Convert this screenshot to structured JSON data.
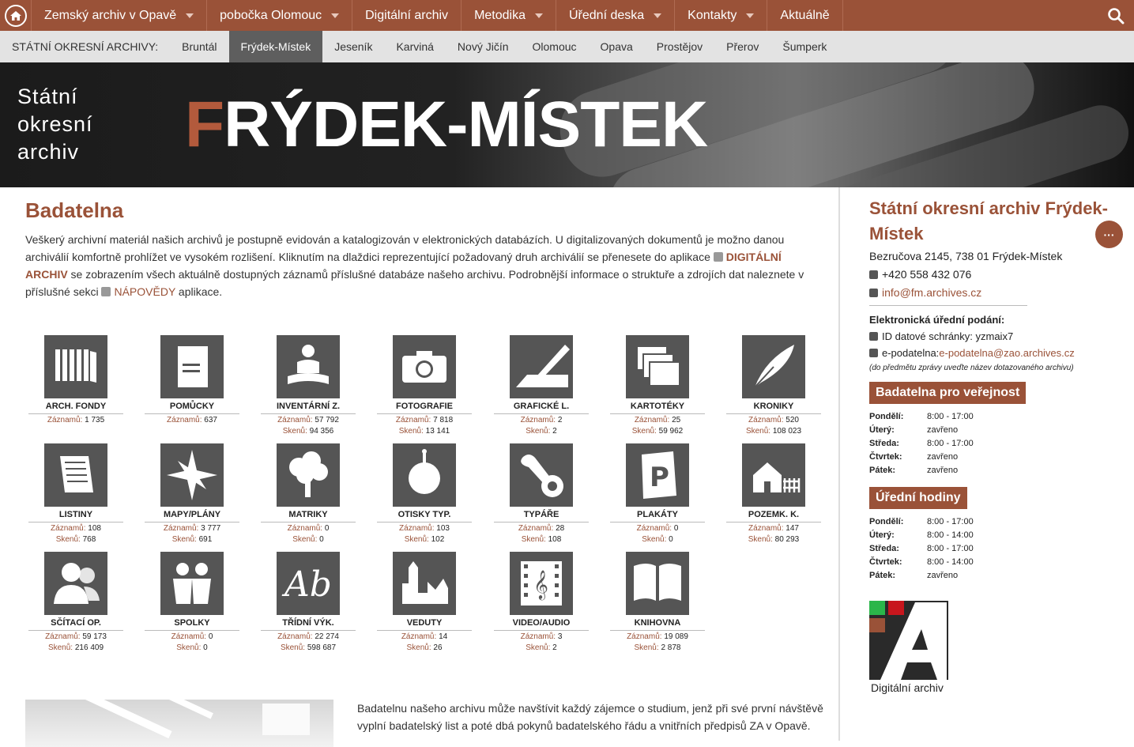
{
  "topnav": {
    "items": [
      {
        "label": "Zemský archiv v Opavě",
        "caret": true
      },
      {
        "label": "pobočka Olomouc",
        "caret": true
      },
      {
        "label": "Digitální archiv",
        "caret": false
      },
      {
        "label": "Metodika",
        "caret": true
      },
      {
        "label": "Úřední deska",
        "caret": true
      },
      {
        "label": "Kontakty",
        "caret": true
      },
      {
        "label": "Aktuálně",
        "caret": false
      }
    ]
  },
  "subnav": {
    "label": "STÁTNÍ OKRESNÍ ARCHIVY:",
    "items": [
      "Bruntál",
      "Frýdek-Místek",
      "Jeseník",
      "Karviná",
      "Nový Jičín",
      "Olomouc",
      "Opava",
      "Prostějov",
      "Přerov",
      "Šumperk"
    ],
    "active": "Frýdek-Místek"
  },
  "banner": {
    "line1": "Státní",
    "line2": "okresní",
    "line3": "archiv",
    "title_first": "F",
    "title_rest": "RÝDEK-MÍSTEK"
  },
  "main": {
    "heading": "Badatelna",
    "intro_1": "Veškerý archivní materiál našich archivů je postupně evidován a katalogizován v elektronických databázích. U digitalizovaných dokumentů je možno danou archiválií komfortně prohlížet ve vysokém rozlišení. Kliknutím na dlaždici reprezentující požadovaný druh archiválií se přenesete do aplikace ",
    "link_digital": "DIGITÁLNÍ ARCHIV",
    "intro_2": " se zobrazením všech aktuálně dostupných záznamů příslušné databáze našeho archivu. Podrobnější informace o struktuře a zdrojích dat naleznete v příslušné sekci ",
    "link_help": "NÁPOVĚDY",
    "intro_3": " aplikace.",
    "bottom_text": "Badatelnu našeho archivu může navštívit každý zájemce o studium, jenž při své první návštěvě vyplní badatelský list a poté dbá pokynů badatelského řádu a vnitřních předpisů ZA v Opavě."
  },
  "labels": {
    "records": "Záznamů:",
    "scans": "Skenů:"
  },
  "tiles": [
    {
      "name": "ARCH. FONDY",
      "icon": "books-icon",
      "records": "1 735",
      "scans": null
    },
    {
      "name": "POMŮCKY",
      "icon": "book-icon",
      "records": "637",
      "scans": null
    },
    {
      "name": "INVENTÁRNÍ Z.",
      "icon": "reader-icon",
      "records": "57 792",
      "scans": "94 356"
    },
    {
      "name": "FOTOGRAFIE",
      "icon": "camera-icon",
      "records": "7 818",
      "scans": "13 141"
    },
    {
      "name": "GRAFICKÉ L.",
      "icon": "engraving-icon",
      "records": "2",
      "scans": "2"
    },
    {
      "name": "KARTOTÉKY",
      "icon": "cards-icon",
      "records": "25",
      "scans": "59 962"
    },
    {
      "name": "KRONIKY",
      "icon": "quill-icon",
      "records": "520",
      "scans": "108 023"
    },
    {
      "name": "LISTINY",
      "icon": "scroll-icon",
      "records": "108",
      "scans": "768"
    },
    {
      "name": "MAPY/PLÁNY",
      "icon": "compass-icon",
      "records": "3 777",
      "scans": "691"
    },
    {
      "name": "MATRIKY",
      "icon": "tree-icon",
      "records": "0",
      "scans": "0"
    },
    {
      "name": "OTISKY TYP.",
      "icon": "seal-icon",
      "records": "103",
      "scans": "102"
    },
    {
      "name": "TYPÁŘE",
      "icon": "stamp-icon",
      "records": "28",
      "scans": "108"
    },
    {
      "name": "PLAKÁTY",
      "icon": "poster-icon",
      "records": "0",
      "scans": "0"
    },
    {
      "name": "POZEMK. K.",
      "icon": "house-icon",
      "records": "147",
      "scans": "80 293"
    },
    {
      "name": "SČÍTACÍ OP.",
      "icon": "people-icon",
      "records": "59 173",
      "scans": "216 409"
    },
    {
      "name": "SPOLKY",
      "icon": "group-icon",
      "records": "0",
      "scans": "0"
    },
    {
      "name": "TŘÍDNÍ VÝK.",
      "icon": "handwriting-icon",
      "records": "22 274",
      "scans": "598 687"
    },
    {
      "name": "VEDUTY",
      "icon": "city-icon",
      "records": "14",
      "scans": "26"
    },
    {
      "name": "VIDEO/AUDIO",
      "icon": "film-icon",
      "records": "3",
      "scans": "2"
    },
    {
      "name": "KNIHOVNA",
      "icon": "open-book-icon",
      "records": "19 089",
      "scans": "2 878"
    }
  ],
  "sidebar": {
    "title": "Státní okresní archiv Frýdek-Místek",
    "address": "Bezručova 2145, 738 01 Frýdek-Místek",
    "phone": "+420 558 432 076",
    "email": "info@fm.archives.cz",
    "edh_title": "Elektronická úřední podání:",
    "ds_label": "ID datové schránky: yzmaix7",
    "ep_label": "e-podatelna: ",
    "ep_email": "e-podatelna@zao.archives.cz",
    "note": "(do předmětu zprávy uveďte název dotazovaného archivu)",
    "badatelna_title": "Badatelna pro veřejnost",
    "badatelna_hours": [
      {
        "day": "Pondělí:",
        "time": "8:00 - 17:00"
      },
      {
        "day": "Úterý:",
        "time": "zavřeno"
      },
      {
        "day": "Středa:",
        "time": "8:00 - 17:00"
      },
      {
        "day": "Čtvrtek:",
        "time": "zavřeno"
      },
      {
        "day": "Pátek:",
        "time": "zavřeno"
      }
    ],
    "uredni_title": "Úřední hodiny",
    "uredni_hours": [
      {
        "day": "Pondělí:",
        "time": "8:00 - 17:00"
      },
      {
        "day": "Úterý:",
        "time": "8:00 - 14:00"
      },
      {
        "day": "Středa:",
        "time": "8:00 - 17:00"
      },
      {
        "day": "Čtvrtek:",
        "time": "8:00 - 14:00"
      },
      {
        "day": "Pátek:",
        "time": "zavřeno"
      }
    ],
    "logo_caption": "Digitální archiv",
    "more_label": "···"
  },
  "colors": {
    "brand": "#9a5238",
    "tile": "#555555",
    "subnav": "#e3e3e3"
  }
}
